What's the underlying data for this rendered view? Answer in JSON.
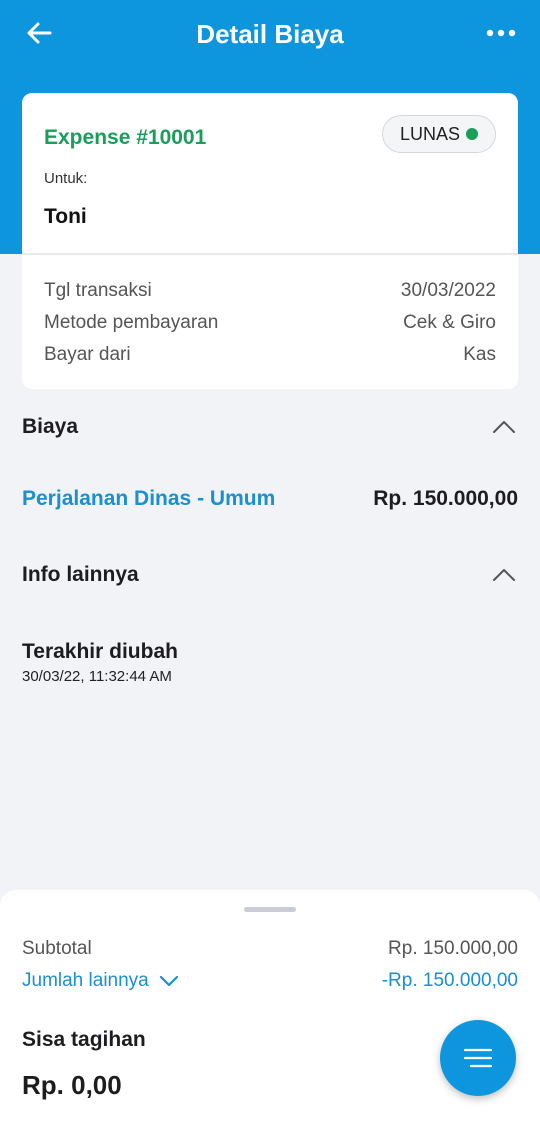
{
  "header": {
    "title": "Detail Biaya",
    "back_icon": "arrow-left-icon",
    "more_icon": "more-horizontal-icon"
  },
  "card": {
    "expense_title": "Expense #10001",
    "status": "LUNAS",
    "for_label": "Untuk:",
    "for_name": "Toni",
    "details": [
      {
        "label": "Tgl transaksi",
        "value": "30/03/2022"
      },
      {
        "label": "Metode pembayaran",
        "value": "Cek & Giro"
      },
      {
        "label": "Bayar dari",
        "value": "Kas"
      }
    ]
  },
  "biaya": {
    "heading": "Biaya",
    "item_name": "Perjalanan Dinas - Umum",
    "item_amount": "Rp.  150.000,00"
  },
  "info": {
    "heading": "Info lainnya",
    "modified_label": "Terakhir diubah",
    "modified_value": "30/03/22, 11:32:44 AM"
  },
  "summary": {
    "subtotal_label": "Subtotal",
    "subtotal_value": "Rp.  150.000,00",
    "other_label": "Jumlah lainnya",
    "other_value": "-Rp. 150.000,00",
    "remaining_label": "Sisa tagihan",
    "remaining_value": "Rp.  0,00"
  },
  "colors": {
    "primary": "#0d96de",
    "success": "#1a9e5a",
    "link": "#1a8fd1",
    "background": "#f2f3f7"
  }
}
